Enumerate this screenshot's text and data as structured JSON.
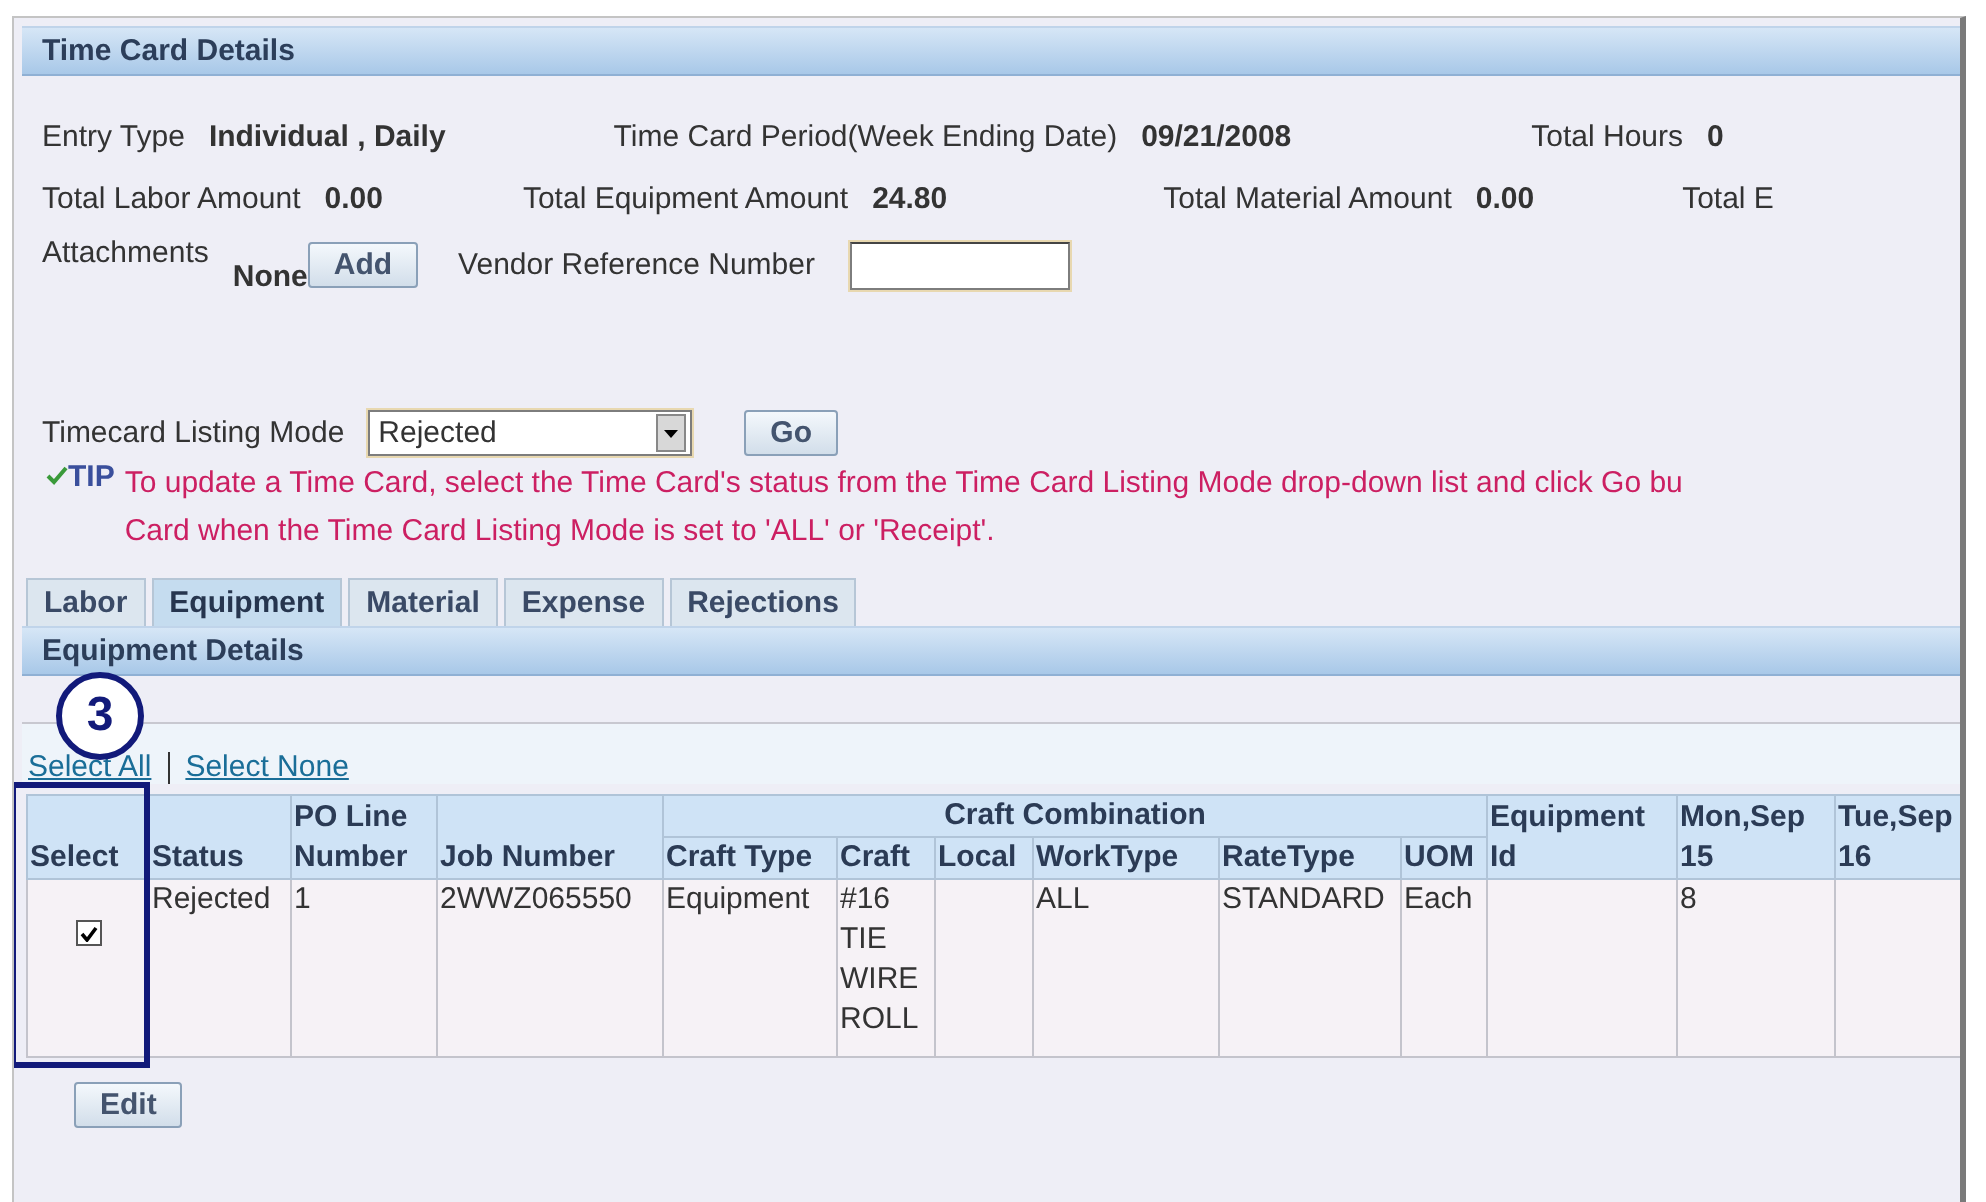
{
  "section_title": "Time Card Details",
  "summary_rows": [
    [
      {
        "label": "Entry Type",
        "value": "Individual , Daily"
      },
      {
        "label": "Time Card Period(Week Ending Date)",
        "value": "09/21/2008"
      },
      {
        "label": "Total Hours",
        "value": "0"
      }
    ],
    [
      {
        "label": "Total Labor Amount",
        "value": "0.00"
      },
      {
        "label": "Total Equipment Amount",
        "value": "24.80"
      },
      {
        "label": "Total Material Amount",
        "value": "0.00"
      },
      {
        "label": "Total E"
      }
    ]
  ],
  "attachments": {
    "label": "Attachments",
    "value": "None",
    "button": "Add"
  },
  "vendor_reference": {
    "label": "Vendor Reference Number"
  },
  "listing_mode": {
    "label": "Timecard Listing Mode",
    "value": "Rejected",
    "button": "Go"
  },
  "tip": {
    "label": "TIP",
    "lines": [
      "To update a Time Card, select the Time Card's status from the Time Card Listing Mode drop-down list and click Go bu",
      "Card when the Time Card Listing Mode is set to 'ALL' or 'Receipt'."
    ]
  },
  "tabs": [
    {
      "label": "Labor",
      "selected": false
    },
    {
      "label": "Equipment",
      "selected": true
    },
    {
      "label": "Material",
      "selected": false
    },
    {
      "label": "Expense",
      "selected": false
    },
    {
      "label": "Rejections",
      "selected": false
    }
  ],
  "details_title": "Equipment Details",
  "callout": "3",
  "select_links": [
    "Select All",
    "Select None"
  ],
  "table": {
    "group_header": "Craft Combination",
    "columns": [
      "Select",
      "Status",
      "PO Line Number",
      "Job Number",
      "Craft Type",
      "Craft",
      "Local",
      "WorkType",
      "RateType",
      "UOM",
      "Equipment Id",
      "Mon,Sep 15",
      "Tue,Sep 16"
    ],
    "rows": [
      {
        "selected": true,
        "cells": [
          "",
          "Rejected",
          "1",
          "2WWZ065550",
          "Equipment",
          "#16 TIE WIRE ROLL",
          "",
          "ALL",
          "STANDARD",
          "Each",
          "",
          "8",
          ""
        ]
      }
    ]
  },
  "buttons": [
    "Edit"
  ]
}
